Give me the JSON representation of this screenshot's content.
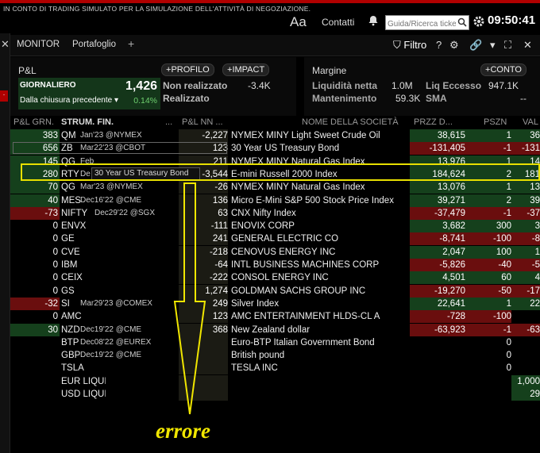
{
  "topbar": {
    "banner": "IN CONTO DI TRADING SIMULATO PER LA SIMULAZIONE DELL'ATTIVITÀ DI NEGOZIAZIONE.",
    "font_size_label": "Aa",
    "contacts": "Contatti",
    "search_placeholder": "Guida/Ricerca ticker",
    "clock": "09:50:41"
  },
  "tabs": [
    {
      "label": "MONITOR"
    },
    {
      "label": "Portafoglio"
    },
    {
      "label": "+"
    }
  ],
  "toolbar": {
    "filter": "Filtro",
    "help": "?"
  },
  "pl": {
    "title": "P&L",
    "profile_btn": "PROFILO",
    "impact_btn": "IMPACT",
    "daily_label": "GIORNALIERO",
    "daily_value": "1,426",
    "since_close_label": "Dalla chiusura precedente",
    "since_close_pct": "0.14%",
    "unrealized_label": "Non realizzato",
    "unrealized_value": "-3.4K",
    "realized_label": "Realizzato"
  },
  "margin": {
    "title": "Margine",
    "account_btn": "CONTO",
    "net_liq_label": "Liquidità netta",
    "net_liq_value": "1.0M",
    "excess_liq_label": "Liq Eccesso",
    "excess_liq_value": "947.1K",
    "maintenance_label": "Mantenimento",
    "maintenance_value": "59.3K",
    "sma_label": "SMA",
    "sma_value": "--"
  },
  "columns": {
    "pl_daily": "P&L GRN.",
    "instrument": "STRUM. FIN.",
    "dots": "...",
    "pl_nn": "P&L NN ...",
    "company": "NOME DELLA SOCIETÀ",
    "price": "PRZZ D...",
    "position": "PSZN",
    "value": "VAL"
  },
  "rows": [
    {
      "pl": "383",
      "inst": "QM",
      "exp": "Jan'23 @NYMEX",
      "nn": "-2,227",
      "name": "NYMEX MINY Light Sweet Crude Oil",
      "price": "38,615",
      "pos": "1",
      "val": "36"
    },
    {
      "pl": "656",
      "inst": "ZB",
      "exp": "Mar22'23 @CBOT",
      "nn": "123",
      "name": "30 Year US Treasury Bond",
      "price": "-131,405",
      "pos": "-1",
      "val": "-131"
    },
    {
      "pl": "145",
      "inst": "QG",
      "exp": "Feb",
      "nn": "211",
      "name": "NYMEX MINY Natural Gas Index",
      "price": "13,976",
      "pos": "1",
      "val": "14"
    },
    {
      "pl": "280",
      "inst": "RTY",
      "exp": "De",
      "nn": "-3,544",
      "name": "E-mini Russell 2000 Index",
      "price": "184,624",
      "pos": "2",
      "val": "181"
    },
    {
      "pl": "70",
      "inst": "QG",
      "exp": "Mar'23 @NYMEX",
      "nn": "-26",
      "name": "NYMEX MINY Natural Gas Index",
      "price": "13,076",
      "pos": "1",
      "val": "13"
    },
    {
      "pl": "40",
      "inst": "MES",
      "exp": "Dec16'22 @CME",
      "nn": "136",
      "name": "Micro E-Mini S&P 500 Stock Price Index",
      "price": "39,271",
      "pos": "2",
      "val": "39"
    },
    {
      "pl": "-73",
      "inst": "NIFTY",
      "exp": "Dec29'22 @SGX",
      "nn": "63",
      "name": "CNX Nifty Index",
      "price": "-37,479",
      "pos": "-1",
      "val": "-37"
    },
    {
      "pl": "0",
      "inst": "ENVX",
      "exp": "",
      "nn": "-111",
      "name": "ENOVIX CORP",
      "price": "3,682",
      "pos": "300",
      "val": "3"
    },
    {
      "pl": "0",
      "inst": "GE",
      "exp": "",
      "nn": "241",
      "name": "GENERAL ELECTRIC CO",
      "price": "-8,741",
      "pos": "-100",
      "val": "-8"
    },
    {
      "pl": "0",
      "inst": "CVE",
      "exp": "",
      "nn": "-218",
      "name": "CENOVUS ENERGY INC",
      "price": "2,047",
      "pos": "100",
      "val": "1"
    },
    {
      "pl": "0",
      "inst": "IBM",
      "exp": "",
      "nn": "-64",
      "name": "INTL BUSINESS MACHINES CORP",
      "price": "-5,826",
      "pos": "-40",
      "val": "-5"
    },
    {
      "pl": "0",
      "inst": "CEIX",
      "exp": "",
      "nn": "-222",
      "name": "CONSOL ENERGY INC",
      "price": "4,501",
      "pos": "60",
      "val": "4"
    },
    {
      "pl": "0",
      "inst": "GS",
      "exp": "",
      "nn": "1,274",
      "name": "GOLDMAN SACHS GROUP INC",
      "price": "-19,270",
      "pos": "-50",
      "val": "-17"
    },
    {
      "pl": "-32",
      "inst": "SI",
      "exp": "Mar29'23 @COMEX",
      "nn": "249",
      "name": "Silver Index",
      "price": "22,641",
      "pos": "1",
      "val": "22"
    },
    {
      "pl": "0",
      "inst": "AMC",
      "exp": "",
      "nn": "123",
      "name": "AMC ENTERTAINMENT HLDS-CL A",
      "price": "-728",
      "pos": "-100",
      "val": ""
    },
    {
      "pl": "30",
      "inst": "NZD",
      "exp": "Dec19'22 @CME",
      "nn": "368",
      "name": "New Zealand dollar",
      "price": "-63,923",
      "pos": "-1",
      "val": "-63"
    },
    {
      "pl": "",
      "inst": "BTP",
      "exp": "Dec08'22 @EUREX",
      "nn": "",
      "name": "Euro-BTP Italian Government Bond",
      "price": "",
      "pos": "0",
      "val": ""
    },
    {
      "pl": "",
      "inst": "GBP",
      "exp": "Dec19'22 @CME",
      "nn": "",
      "name": "British pound",
      "price": "",
      "pos": "0",
      "val": ""
    },
    {
      "pl": "",
      "inst": "TSLA",
      "exp": "",
      "nn": "",
      "name": "TESLA INC",
      "price": "",
      "pos": "0",
      "val": ""
    },
    {
      "pl": "",
      "inst": "EUR LIQUIDITÀ",
      "exp": "",
      "nn": "",
      "name": "",
      "price": "",
      "pos": "",
      "val": "1,000"
    },
    {
      "pl": "",
      "inst": "USD LIQUIDITÀ",
      "exp": "",
      "nn": "",
      "name": "",
      "price": "",
      "pos": "",
      "val": "29"
    }
  ],
  "tooltip": "30 Year US Treasury Bond",
  "tooltip_prefix": "ZB Mar22'23 @CBOT",
  "annotation": "errore",
  "colors": {
    "green": "#15401c",
    "red": "#6a0e0e",
    "highlight": "#e8e000"
  }
}
